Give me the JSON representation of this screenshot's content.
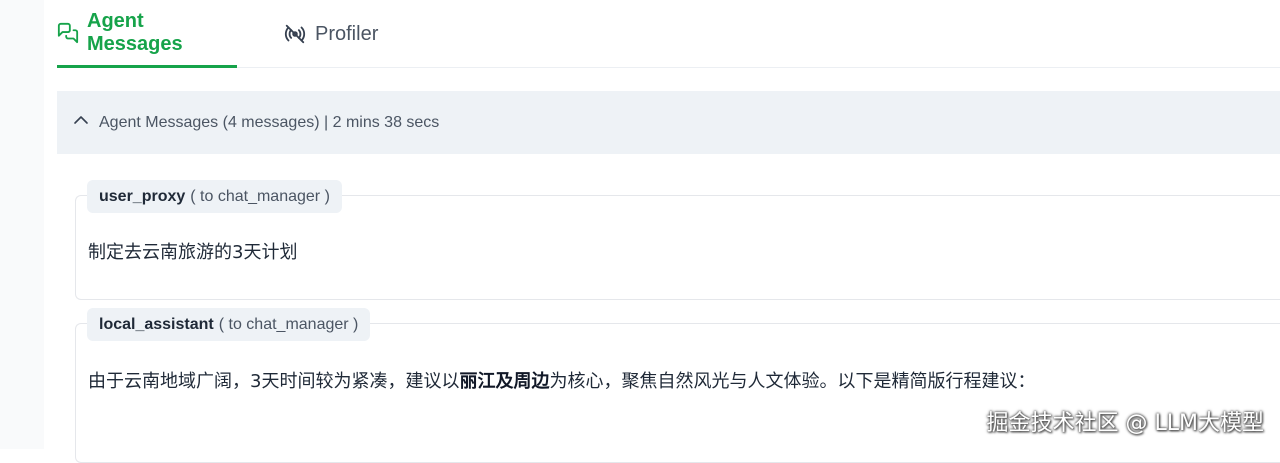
{
  "tabs": {
    "agent_messages": "Agent Messages",
    "profiler": "Profiler"
  },
  "panel": {
    "header": "Agent Messages (4 messages) | 2 mins 38 secs"
  },
  "messages": [
    {
      "sender": "user_proxy",
      "recipient": "( to chat_manager )",
      "text": "制定去云南旅游的3天计划"
    },
    {
      "sender": "local_assistant",
      "recipient": "( to chat_manager )",
      "text_before": "由于云南地域广阔，3天时间较为紧凑，建议以",
      "text_bold": "丽江及周边",
      "text_after": "为核心，聚焦自然风光与人文体验。以下是精简版行程建议："
    }
  ],
  "watermark": "掘金技术社区 @ LLM大模型",
  "colors": {
    "accent": "#16a34a",
    "panel_bg": "#eef2f6",
    "tag_bg": "#eef2f6"
  },
  "icons": {
    "agent_messages": "chat-bubbles-icon",
    "profiler": "broadcast-signal-icon",
    "collapse": "chevron-up-icon"
  }
}
